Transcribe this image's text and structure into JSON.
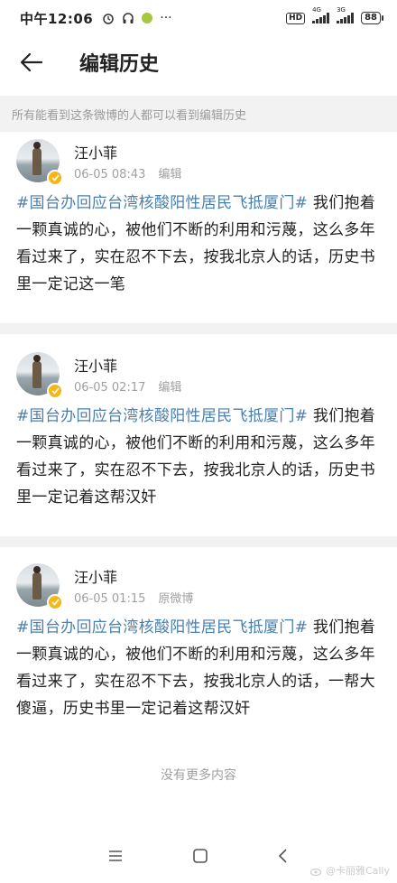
{
  "status_bar": {
    "time": "中午12:06",
    "hd": "HD",
    "signal1_label": "4G",
    "signal2_label": "3G",
    "battery": "88"
  },
  "header": {
    "title": "编辑历史"
  },
  "notice": "所有能看到这条微博的人都可以看到编辑历史",
  "posts": [
    {
      "username": "汪小菲",
      "time": "06-05 08:43",
      "tag": "编辑",
      "topic": "#国台办回应台湾核酸阳性居民飞抵厦门#",
      "text": " 我们抱着一颗真诚的心，被他们不断的利用和污蔑，这么多年看过来了，实在忍不下去，按我北京人的话，历史书里一定记这一笔"
    },
    {
      "username": "汪小菲",
      "time": "06-05 02:17",
      "tag": "编辑",
      "topic": "#国台办回应台湾核酸阳性居民飞抵厦门#",
      "text": " 我们抱着一颗真诚的心，被他们不断的利用和污蔑，这么多年看过来了，实在忍不下去，按我北京人的话，历史书里一定记着这帮汉奸"
    },
    {
      "username": "汪小菲",
      "time": "06-05 01:15",
      "tag": "原微博",
      "topic": "#国台办回应台湾核酸阳性居民飞抵厦门#",
      "text": " 我们抱着一颗真诚的心，被他们不断的利用和污蔑，这么多年看过来了，实在忍不下去，按我北京人的话，一帮大傻逼，历史书里一定记着这帮汉奸"
    }
  ],
  "footer": {
    "no_more": "没有更多内容"
  },
  "watermark": "@卡丽雅Cally",
  "icons": {
    "back": "arrow-left-icon",
    "verified": "verified-badge-icon",
    "nav_menu": "menu-icon",
    "nav_home": "home-square-icon",
    "nav_back": "chevron-left-icon"
  },
  "colors": {
    "topic": "#4b7fad",
    "meta": "#a0a0a0",
    "divider": "#f2f2f2",
    "verified": "#f6b715"
  }
}
